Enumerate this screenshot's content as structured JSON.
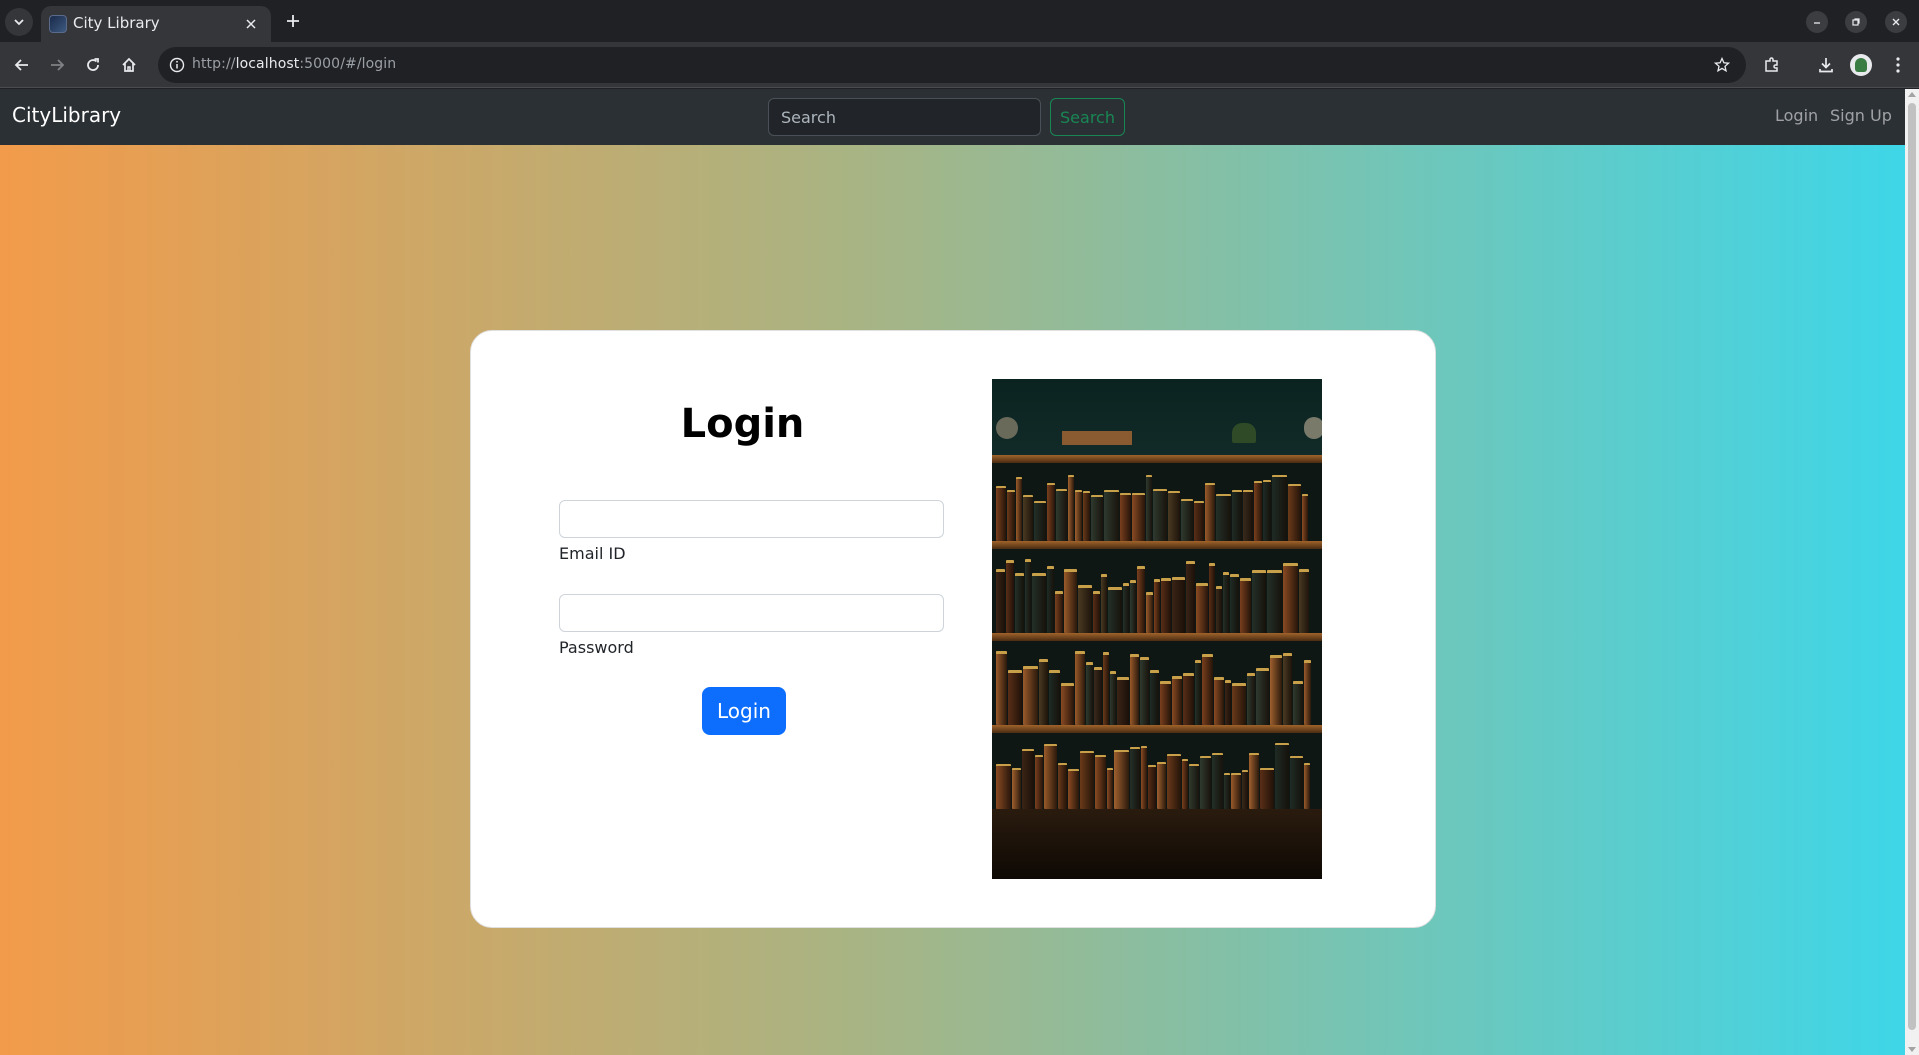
{
  "browser": {
    "tab_title": "City Library",
    "url_scheme": "http://",
    "url_host": "localhost",
    "url_rest": ":5000/#/login"
  },
  "navbar": {
    "brand": "CityLibrary",
    "search_placeholder": "Search",
    "search_button": "Search",
    "login_link": "Login",
    "signup_link": "Sign Up"
  },
  "login_form": {
    "title": "Login",
    "email_label": "Email ID",
    "email_value": "",
    "password_label": "Password",
    "password_value": "",
    "submit_label": "Login"
  },
  "colors": {
    "navbar_bg": "#2b3035",
    "search_button_accent": "#198754",
    "primary_button": "#0d6efd",
    "gradient_start": "#f29b4a",
    "gradient_end": "#3ed6e8"
  },
  "icons": {
    "image": "bookshelf-image"
  }
}
